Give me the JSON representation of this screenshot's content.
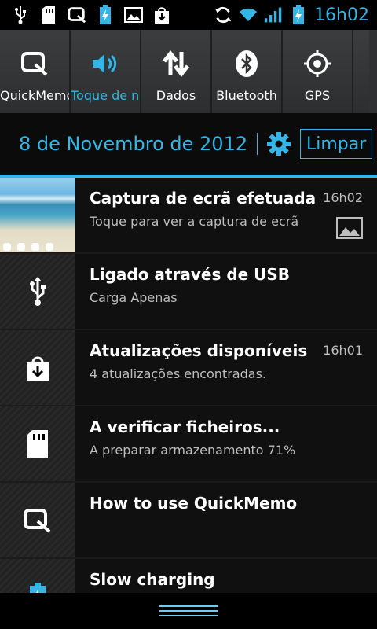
{
  "status_bar": {
    "left_icons": [
      "usb-icon",
      "sd-card-icon",
      "quickmemo-icon",
      "battery-charging-icon",
      "image-icon",
      "download-icon"
    ],
    "right_icons": [
      "sync-icon",
      "wifi-icon",
      "signal-icon",
      "battery-icon"
    ],
    "time": "16h02",
    "accent_color": "#33b5e5"
  },
  "quick_settings": [
    {
      "label": "QuickMemo",
      "icon": "quickmemo-icon",
      "active": false
    },
    {
      "label": "Toque de notificação",
      "icon": "volume-icon",
      "active": true
    },
    {
      "label": "Dados",
      "icon": "data-arrows-icon",
      "active": false
    },
    {
      "label": "Bluetooth",
      "icon": "bluetooth-icon",
      "active": false
    },
    {
      "label": "GPS",
      "icon": "gps-icon",
      "active": false
    }
  ],
  "header": {
    "date": "8 de Novembro de 2012",
    "clear_label": "Limpar",
    "settings_icon": "gear-icon"
  },
  "notifications": [
    {
      "title": "Captura de ecrã efetuada",
      "subtitle": "Toque para ver a captura de ecrã",
      "time": "16h02",
      "icon": "screenshot-thumbnail",
      "right_icon": "image-icon"
    },
    {
      "title": "Ligado através de USB",
      "subtitle": "Carga Apenas",
      "time": "",
      "icon": "usb-icon"
    },
    {
      "title": "Atualizações disponíveis",
      "subtitle": "4 atualizações encontradas.",
      "time": "16h01",
      "icon": "download-icon"
    },
    {
      "title": "A verificar ficheiros...",
      "subtitle": "A preparar armazenamento  71%",
      "time": "",
      "icon": "sd-card-icon"
    },
    {
      "title": "How to use QuickMemo",
      "subtitle": "",
      "time": "",
      "icon": "quickmemo-icon"
    },
    {
      "title": "Slow charging",
      "subtitle": "",
      "time": "",
      "icon": "battery-charging-icon"
    }
  ],
  "bottom": {
    "handle_icon": "drag-handle-icon"
  }
}
